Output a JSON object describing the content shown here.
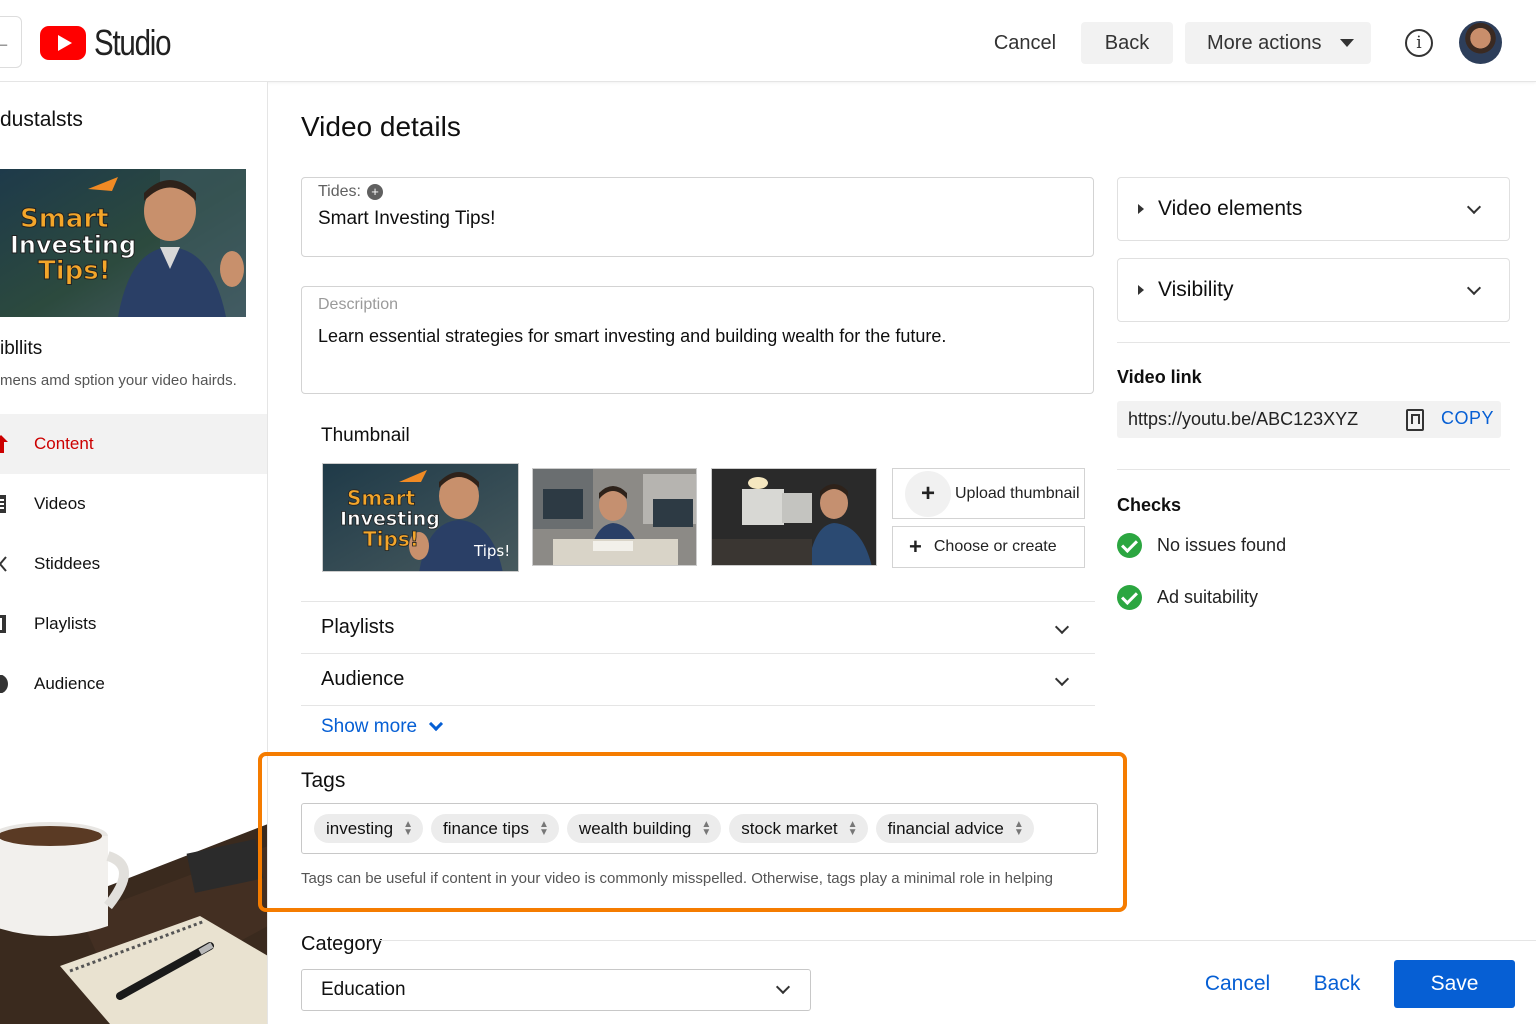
{
  "app": {
    "title": "Studio"
  },
  "header": {
    "cancel_label": "Cancel",
    "back_label": "Back",
    "more_actions_label": "More actions"
  },
  "sidebar": {
    "channel_name": "dustalsts",
    "thumb_text": [
      "Smart",
      "Investing",
      "Tips!"
    ],
    "sub_title": "ibllits",
    "sub_desc": "mens amd sption your video hairds.",
    "items": [
      {
        "label": "Content",
        "icon": "content-icon",
        "active": true
      },
      {
        "label": "Videos",
        "icon": "videos-icon",
        "active": false
      },
      {
        "label": "Stiddees",
        "icon": "share-icon",
        "active": false
      },
      {
        "label": "Playlists",
        "icon": "playlists-icon",
        "active": false
      },
      {
        "label": "Audience",
        "icon": "audience-icon",
        "active": false
      }
    ]
  },
  "main": {
    "page_title": "Video details",
    "title_field": {
      "label": "Tides:",
      "value": "Smart Investing Tips!"
    },
    "description_field": {
      "label": "Description",
      "value": "Learn essential strategies for smart investing and building wealth for the future."
    },
    "thumbnail": {
      "label": "Thumbnail",
      "main_text": [
        "Smart",
        "Investing",
        "Tips!"
      ],
      "main_badge": "Tips!",
      "upload_label": "Upload thumbnail",
      "choose_label": "Choose or create"
    },
    "playlists_label": "Playlists",
    "audience_label": "Audience",
    "show_more_label": "Show more",
    "tags": {
      "title": "Tags",
      "chips": [
        "investing",
        "finance tips",
        "wealth building",
        "stock market",
        "financial advice"
      ],
      "help": "Tags can be useful if content in your video is commonly misspelled. Otherwise, tags play a minimal role in helping"
    },
    "category": {
      "label": "Category",
      "value": "Education"
    }
  },
  "right": {
    "video_elements_label": "Video elements",
    "visibility_label": "Visibility",
    "video_link_label": "Video link",
    "video_link_value": "https://youtu.be/ABC123XYZ",
    "copy_label": "COPY",
    "checks_label": "Checks",
    "checks": [
      "No issues found",
      "Ad suitability"
    ]
  },
  "footer": {
    "cancel_label": "Cancel",
    "back_label": "Back",
    "save_label": "Save"
  },
  "colors": {
    "accent": "#065fd4",
    "highlight": "#f57c00",
    "brand_red": "#ff0000",
    "check_green": "#2ba640"
  }
}
